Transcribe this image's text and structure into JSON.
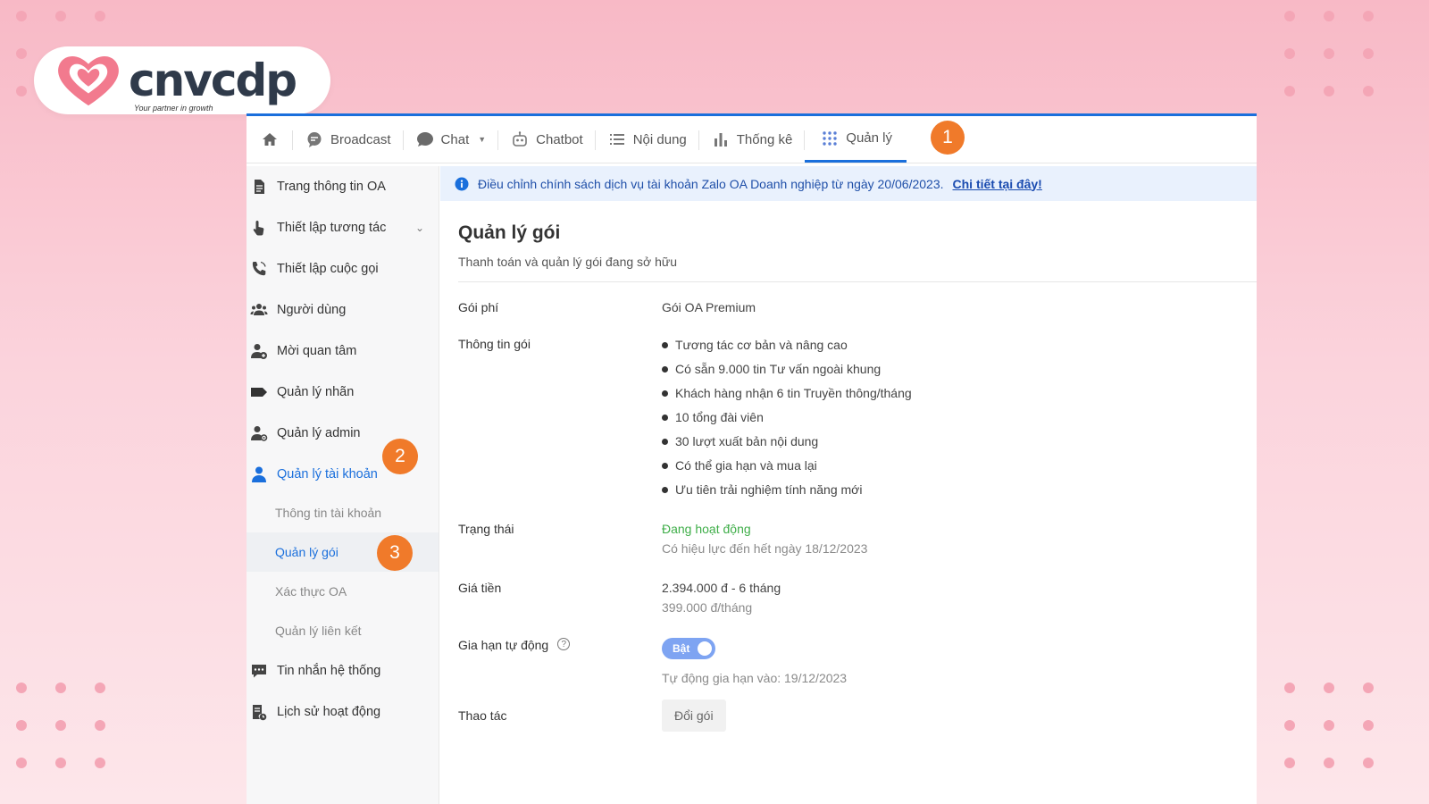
{
  "brand": {
    "name": "cnvcdp",
    "tagline": "Your partner in growth",
    "heart_color": "#f27a8e"
  },
  "nav": {
    "items": [
      {
        "key": "home",
        "label": ""
      },
      {
        "key": "broadcast",
        "label": "Broadcast"
      },
      {
        "key": "chat",
        "label": "Chat"
      },
      {
        "key": "chatbot",
        "label": "Chatbot"
      },
      {
        "key": "content",
        "label": "Nội dung"
      },
      {
        "key": "stats",
        "label": "Thống kê"
      },
      {
        "key": "manage",
        "label": "Quản lý"
      }
    ],
    "active": "Quản lý",
    "badge": "1"
  },
  "notice": {
    "text": "Điều chỉnh chính sách dịch vụ tài khoản Zalo OA Doanh nghiệp từ ngày 20/06/2023.",
    "link": "Chi tiết tại đây!"
  },
  "sidebar": {
    "items": [
      {
        "label": "Trang thông tin OA"
      },
      {
        "label": "Thiết lập tương tác"
      },
      {
        "label": "Thiết lập cuộc gọi"
      },
      {
        "label": "Người dùng"
      },
      {
        "label": "Mời quan tâm"
      },
      {
        "label": "Quản lý nhãn"
      },
      {
        "label": "Quản lý admin"
      },
      {
        "label": "Quản lý tài khoản"
      }
    ],
    "subitems": [
      {
        "label": "Thông tin tài khoản"
      },
      {
        "label": "Quản lý gói"
      },
      {
        "label": "Xác thực OA"
      },
      {
        "label": "Quản lý liên kết"
      }
    ],
    "bottom_items": [
      {
        "label": "Tin nhắn hệ thống"
      },
      {
        "label": "Lịch sử hoạt động"
      }
    ],
    "badge_account": "2",
    "badge_package": "3"
  },
  "page": {
    "title": "Quản lý gói",
    "subtitle": "Thanh toán và quản lý gói đang sở hữu",
    "fee_label": "Gói phí",
    "fee_value": "Gói OA Premium",
    "info_label": "Thông tin gói",
    "info_items": [
      "Tương tác cơ bản và nâng cao",
      "Có sẵn 9.000 tin Tư vấn ngoài khung",
      "Khách hàng nhận 6 tin Truyền thông/tháng",
      "10 tổng đài viên",
      "30 lượt xuất bản nội dung",
      "Có thể gia hạn và mua lại",
      "Ưu tiên trải nghiệm tính năng mới"
    ],
    "status_label": "Trạng thái",
    "status_value": "Đang hoạt động",
    "status_note": "Có hiệu lực đến hết ngày 18/12/2023",
    "price_label": "Giá tiền",
    "price_value": "2.394.000 đ - 6 tháng",
    "price_note": "399.000 đ/tháng",
    "renew_label": "Gia hạn tự động",
    "renew_toggle": "Bật",
    "renew_note": "Tự động gia hạn vào: 19/12/2023",
    "action_label": "Thao tác",
    "action_button": "Đổi gói"
  }
}
